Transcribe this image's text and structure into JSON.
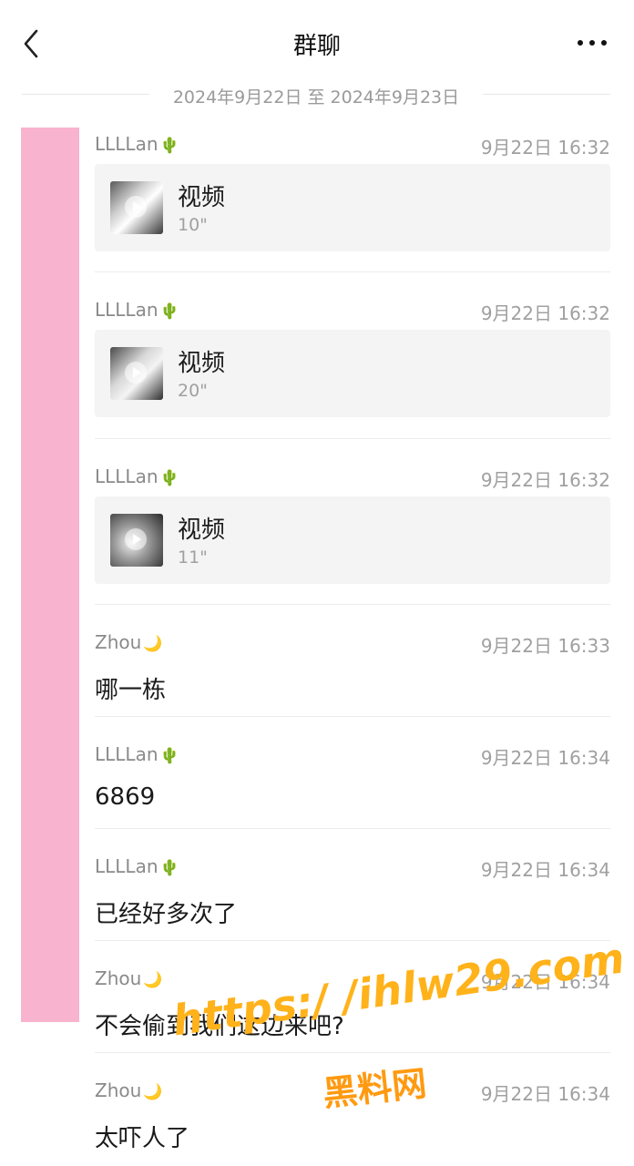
{
  "header": {
    "title": "群聊"
  },
  "date_range": "2024年9月22日 至 2024年9月23日",
  "messages": [
    {
      "sender": "LLLLan",
      "emoji": "🌵",
      "time": "9月22日 16:32",
      "type": "video",
      "label": "视频",
      "duration": "10\""
    },
    {
      "sender": "LLLLan",
      "emoji": "🌵",
      "time": "9月22日 16:32",
      "type": "video",
      "label": "视频",
      "duration": "20\""
    },
    {
      "sender": "LLLLan",
      "emoji": "🌵",
      "time": "9月22日 16:32",
      "type": "video",
      "label": "视频",
      "duration": "11\""
    },
    {
      "sender": "Zhou",
      "emoji": "🌙",
      "time": "9月22日 16:33",
      "type": "text",
      "text": "哪一栋"
    },
    {
      "sender": "LLLLan",
      "emoji": "🌵",
      "time": "9月22日 16:34",
      "type": "text",
      "text": "6869"
    },
    {
      "sender": "LLLLan",
      "emoji": "🌵",
      "time": "9月22日 16:34",
      "type": "text",
      "text": "已经好多次了"
    },
    {
      "sender": "Zhou",
      "emoji": "🌙",
      "time": "9月22日 16:34",
      "type": "text",
      "text": "不会偷到我们这边来吧?"
    },
    {
      "sender": "Zhou",
      "emoji": "🌙",
      "time": "9月22日 16:34",
      "type": "text",
      "text": "太吓人了"
    }
  ],
  "watermark": {
    "url": "https:/ /ihlw29.com",
    "site": "黑料网"
  },
  "colors": {
    "highlight_bar": "#f8b3ce",
    "watermark": "#ffb21a"
  }
}
